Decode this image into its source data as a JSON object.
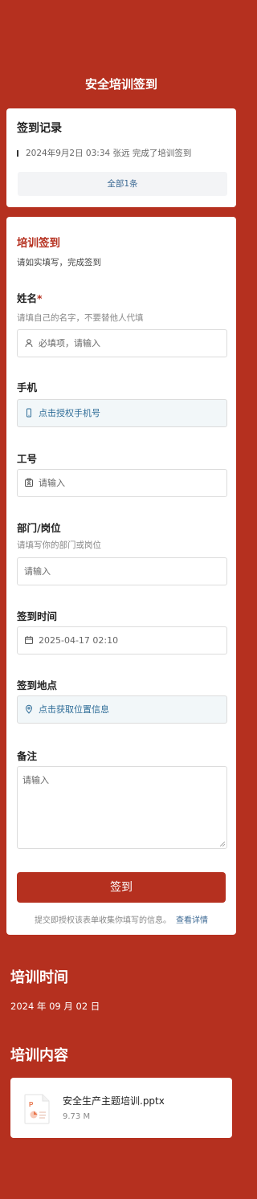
{
  "header": {
    "title": "安全培训签到"
  },
  "records": {
    "title": "签到记录",
    "items": [
      {
        "text": "2024年9月2日 03:34  张远 完成了培训签到"
      }
    ],
    "all_label": "全部1条"
  },
  "form": {
    "title": "培训签到",
    "description": "请如实填写，完成签到",
    "name": {
      "label": "姓名",
      "required_mark": "*",
      "hint": "请填自己的名字，不要替他人代填",
      "placeholder": "必填项，请输入",
      "icon": "user-icon"
    },
    "phone": {
      "label": "手机",
      "action": "点击授权手机号",
      "icon": "phone-icon"
    },
    "employee_id": {
      "label": "工号",
      "placeholder": "请输入",
      "icon": "id-card-icon"
    },
    "department": {
      "label": "部门/岗位",
      "hint": "请填写你的部门或岗位",
      "placeholder": "请输入"
    },
    "checkin_time": {
      "label": "签到时间",
      "value": "2025-04-17 02:10",
      "icon": "calendar-icon"
    },
    "location": {
      "label": "签到地点",
      "action": "点击获取位置信息",
      "icon": "location-pin-icon"
    },
    "remark": {
      "label": "备注",
      "placeholder": "请输入"
    },
    "submit_label": "签到",
    "privacy_text": "提交即授权该表单收集你填写的信息。",
    "privacy_link": "查看详情"
  },
  "training_time": {
    "heading": "培训时间",
    "value": "2024 年 09 月 02 日"
  },
  "training_content": {
    "heading": "培训内容",
    "files": [
      {
        "name": "安全生产主题培训.pptx",
        "size": "9.73 M",
        "icon": "pptx-file-icon"
      }
    ]
  },
  "colors": {
    "brand": "#b5301f",
    "link": "#3d6a94",
    "tint": "#f2f7f9"
  }
}
